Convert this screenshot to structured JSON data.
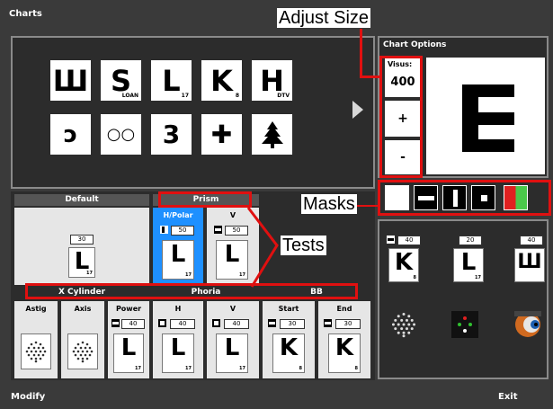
{
  "window": {
    "title": "Charts"
  },
  "footer": {
    "modify_label": "Modify",
    "exit_label": "Exit"
  },
  "charts_grid": {
    "row1": [
      {
        "glyph": "Ш",
        "sub": ""
      },
      {
        "glyph": "S",
        "sub": "LOAN"
      },
      {
        "glyph": "L",
        "sub": "17"
      },
      {
        "glyph": "K",
        "sub": "8"
      },
      {
        "glyph": "H",
        "sub": "DTV"
      }
    ],
    "row2": [
      {
        "glyph": "ↄ"
      },
      {
        "glyph": "○○"
      },
      {
        "glyph": "3"
      },
      {
        "glyph": "✚"
      },
      {
        "glyph": "▲"
      }
    ]
  },
  "chart_options": {
    "title": "Chart Options",
    "visus_label": "Visus:",
    "visus_value": "400",
    "plus_label": "+",
    "minus_label": "-",
    "preview_letter": "E"
  },
  "tests": {
    "default_label": "Default",
    "default_value": "30",
    "default_letter": "L",
    "default_sub": "17",
    "prism_label": "Prism",
    "prism_items": [
      {
        "label": "H/Polar",
        "value": "50",
        "letter": "L",
        "sub": "17",
        "active": true
      },
      {
        "label": "V",
        "value": "50",
        "letter": "L",
        "sub": "17",
        "active": false
      }
    ],
    "groups": [
      {
        "label": "X Cylinder"
      },
      {
        "label": "Phoria"
      },
      {
        "label": "BB"
      }
    ],
    "xcyl_items": [
      {
        "label": "Astig"
      },
      {
        "label": "Axis"
      },
      {
        "label": "Power",
        "value": "40",
        "letter": "L",
        "sub": "17"
      }
    ],
    "phoria_items": [
      {
        "label": "H",
        "value": "40",
        "letter": "L",
        "sub": "17"
      },
      {
        "label": "V",
        "value": "40",
        "letter": "L",
        "sub": "17"
      }
    ],
    "bb_items": [
      {
        "label": "Start",
        "value": "30",
        "letter": "K",
        "sub": "8"
      },
      {
        "label": "End",
        "value": "30",
        "letter": "K",
        "sub": "8"
      }
    ]
  },
  "right_panel": {
    "items": [
      {
        "value": "40",
        "letter": "K",
        "sub": "8"
      },
      {
        "value": "20",
        "letter": "L",
        "sub": "17"
      },
      {
        "value": "40",
        "letter": "Ш",
        "sub": ""
      }
    ]
  },
  "annotations": {
    "adjust_size": "Adjust Size",
    "masks": "Masks",
    "tests": "Tests"
  },
  "colors": {
    "highlight": "#e01010",
    "active_blue": "#1e90ff",
    "panel_bg": "#2c2c2c",
    "frame": "#8a8a8a"
  }
}
